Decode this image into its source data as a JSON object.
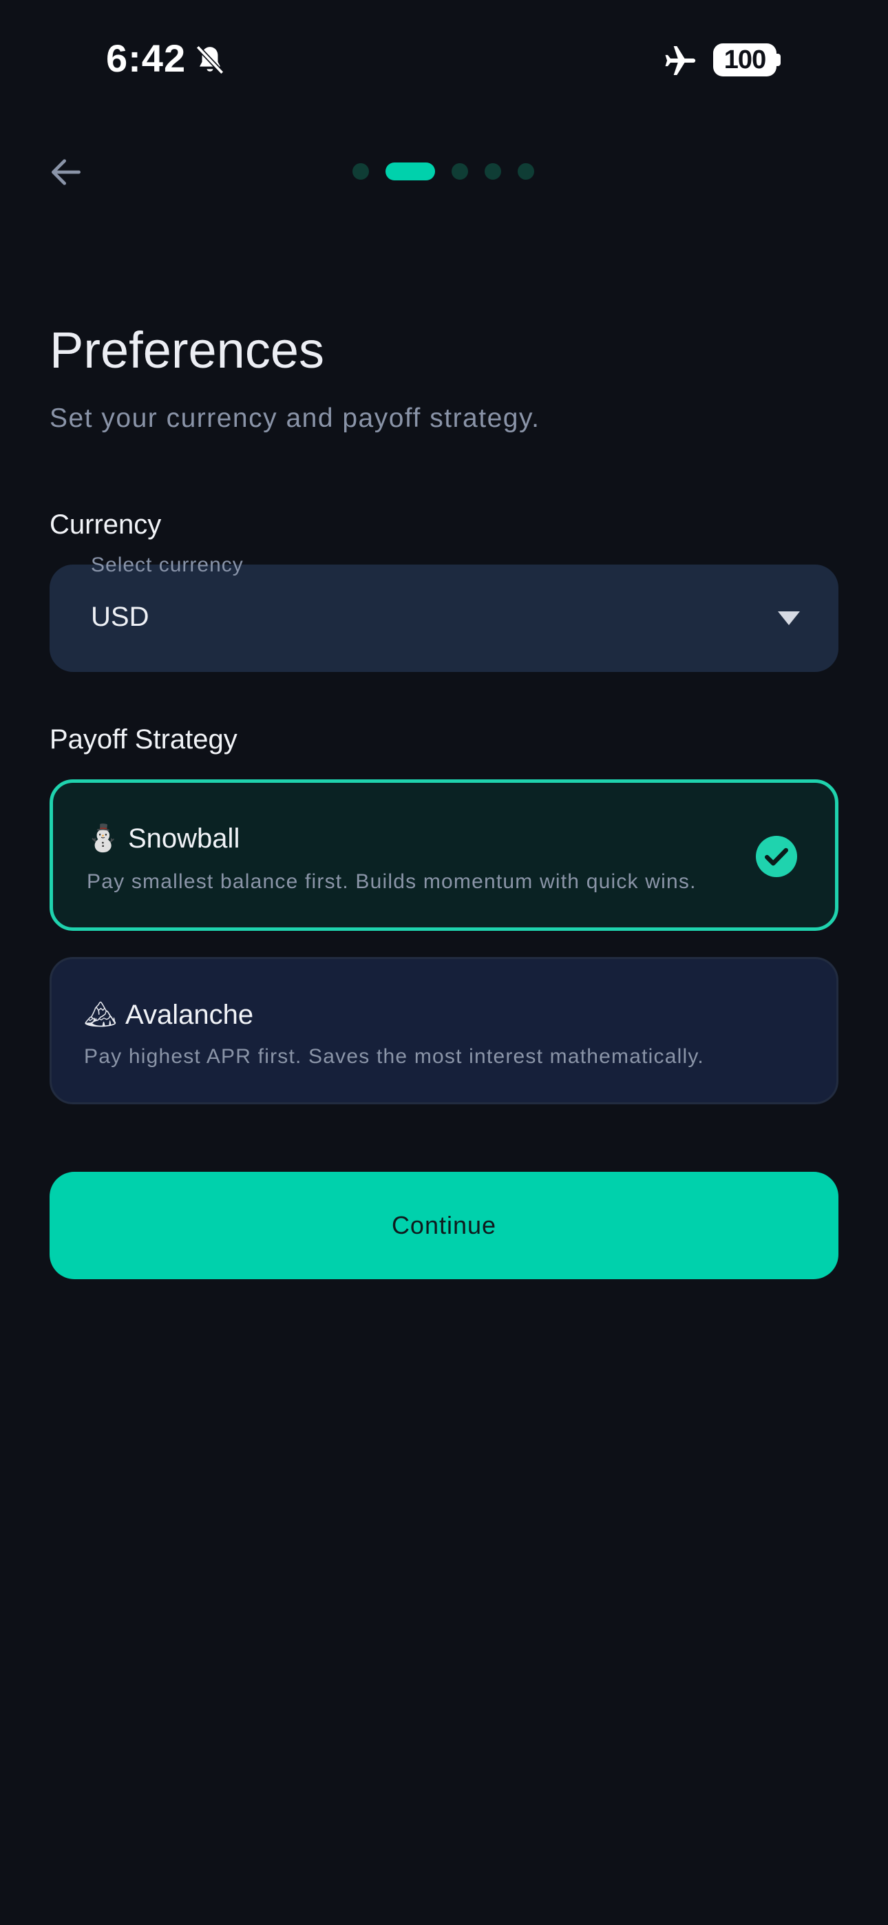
{
  "status_bar": {
    "time": "6:42",
    "battery": "100"
  },
  "nav": {
    "progress_steps": 5,
    "active_step": 2
  },
  "header": {
    "title": "Preferences",
    "subtitle": "Set your currency and payoff strategy."
  },
  "currency": {
    "section_label": "Currency",
    "select_label": "Select currency",
    "value": "USD"
  },
  "strategy": {
    "section_label": "Payoff Strategy",
    "options": [
      {
        "emoji": "⛄",
        "title": "Snowball",
        "description": "Pay smallest balance first. Builds momentum with quick wins.",
        "selected": true
      },
      {
        "emoji": "🏔",
        "title": "Avalanche",
        "description": "Pay highest APR first. Saves the most interest mathematically.",
        "selected": false
      }
    ]
  },
  "actions": {
    "continue_label": "Continue"
  },
  "colors": {
    "accent": "#00d1ac",
    "background": "#0d1017",
    "field": "#1d2a40"
  }
}
